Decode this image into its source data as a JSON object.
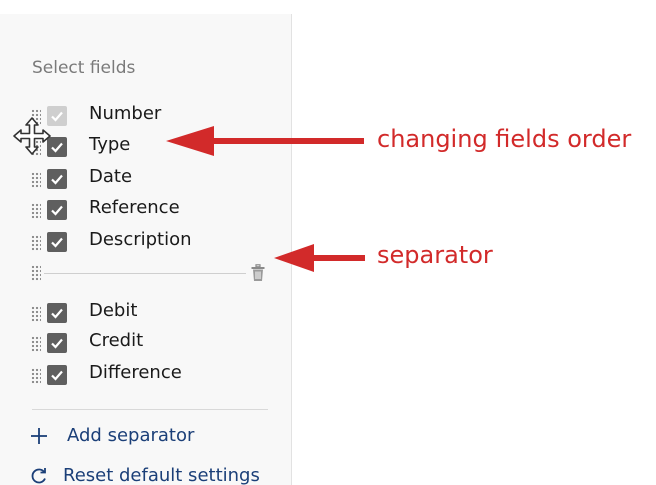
{
  "panel": {
    "title": "Select fields",
    "fields": [
      {
        "label": "Number",
        "checked": true,
        "disabled": true
      },
      {
        "label": "Type",
        "checked": true,
        "disabled": false
      },
      {
        "label": "Date",
        "checked": true,
        "disabled": false
      },
      {
        "label": "Reference",
        "checked": true,
        "disabled": false
      },
      {
        "label": "Description",
        "checked": true,
        "disabled": false
      },
      {
        "label": "Debit",
        "checked": true,
        "disabled": false
      },
      {
        "label": "Credit",
        "checked": true,
        "disabled": false
      },
      {
        "label": "Difference",
        "checked": true,
        "disabled": false
      }
    ],
    "actions": {
      "add_separator": "Add separator",
      "reset_defaults": "Reset default settings"
    }
  },
  "annotations": {
    "changing_order": "changing fields order",
    "separator": "separator"
  },
  "icons": {
    "grip": "drag-handle-icon",
    "trash": "trash-icon",
    "plus": "plus-icon",
    "reset": "reset-icon",
    "move_cursor": "move-cursor-icon"
  },
  "colors": {
    "annotation": "#d22a2a",
    "action_text": "#1b3f78",
    "checkbox": "#5f5f5f",
    "checkbox_disabled": "#cfcfcf"
  }
}
